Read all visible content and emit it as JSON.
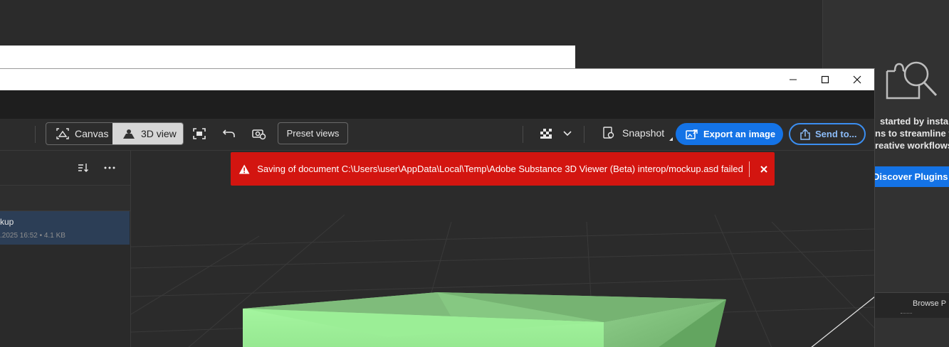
{
  "background_app": {
    "right_panel": {
      "text_lines": [
        "started by installin",
        "ns to streamline yo",
        "reative workflows."
      ],
      "discover_label": "Discover Plugins",
      "browse_label": "Browse P",
      "icon": "plugin-search-icon"
    }
  },
  "window": {
    "controls": {
      "minimize": "minimize-icon",
      "maximize": "maximize-icon",
      "close": "close-icon"
    }
  },
  "toolbar": {
    "canvas_label": "Canvas",
    "view3d_label": "3D view",
    "preset_label": "Preset views",
    "snapshot_label": "Snapshot",
    "export_label": "Export an image",
    "send_label": "Send to...",
    "accent_color": "#1473e6"
  },
  "left_panel": {
    "item": {
      "name": "kup",
      "meta": ".2025 16:52 • 4.1 KB"
    }
  },
  "toast": {
    "message": "Saving of document C:\\Users\\user\\AppData\\Local\\Temp\\Adobe Substance 3D Viewer (Beta) interop/mockup.asd failed",
    "color": "#d31510"
  },
  "model": {
    "color": "#9ef09a"
  }
}
